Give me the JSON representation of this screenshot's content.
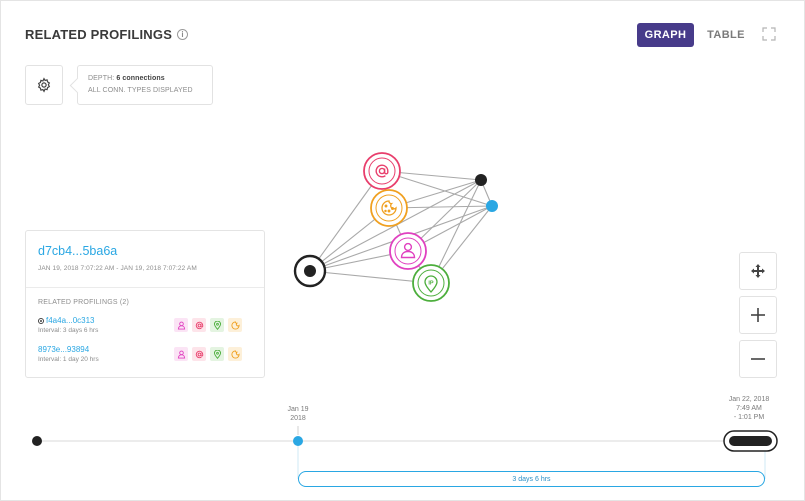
{
  "header": {
    "title": "RELATED PROFILINGS",
    "info_icon": "info-icon",
    "graph_label": "GRAPH",
    "table_label": "TABLE",
    "expand_icon": "expand-icon"
  },
  "settings": {
    "icon": "gear-icon",
    "depth_prefix": "DEPTH:",
    "depth_value": "6 connections",
    "types": "ALL CONN. TYPES DISPLAYED"
  },
  "graph_nodes": [
    {
      "name": "origin-node",
      "icon": "target"
    },
    {
      "name": "email-node",
      "icon": "at-sign",
      "color": "#e83e6c"
    },
    {
      "name": "cookie-node",
      "icon": "cookie",
      "color": "#f0a020"
    },
    {
      "name": "user-node",
      "icon": "user",
      "color": "#e040c0"
    },
    {
      "name": "ip-node",
      "icon": "ip-pin",
      "color": "#4cae3c"
    },
    {
      "name": "black-node",
      "color": "#222222"
    },
    {
      "name": "blue-node",
      "color": "#2aa7e3"
    }
  ],
  "panel": {
    "id": "d7cb4...5ba6a",
    "dates": "JAN 19, 2018 7:07:22 AM - JAN 19, 2018 7:07:22 AM",
    "related_label": "RELATED PROFILINGS (2)",
    "items": [
      {
        "id": "f4a4a...0c313",
        "interval": "Interval: 3 days 6 hrs"
      },
      {
        "id": "8973e...93894",
        "interval": "Interval: 1 day 20 hrs"
      }
    ]
  },
  "zoom": {
    "fit_icon": "fit-arrows-icon",
    "plus_icon": "plus-icon",
    "minus_icon": "minus-icon"
  },
  "timeline": {
    "start_line1": "Jan 19",
    "start_line2": "2018",
    "end_line1": "Jan 22, 2018",
    "end_line2": "7:49 AM",
    "end_line3": "- 1:01 PM",
    "duration": "3 days 6 hrs"
  },
  "colors": {
    "accent": "#473b8a",
    "link": "#2aa7e3",
    "email": "#e83e6c",
    "cookie": "#f0a020",
    "user": "#e040c0",
    "ip": "#4cae3c"
  }
}
